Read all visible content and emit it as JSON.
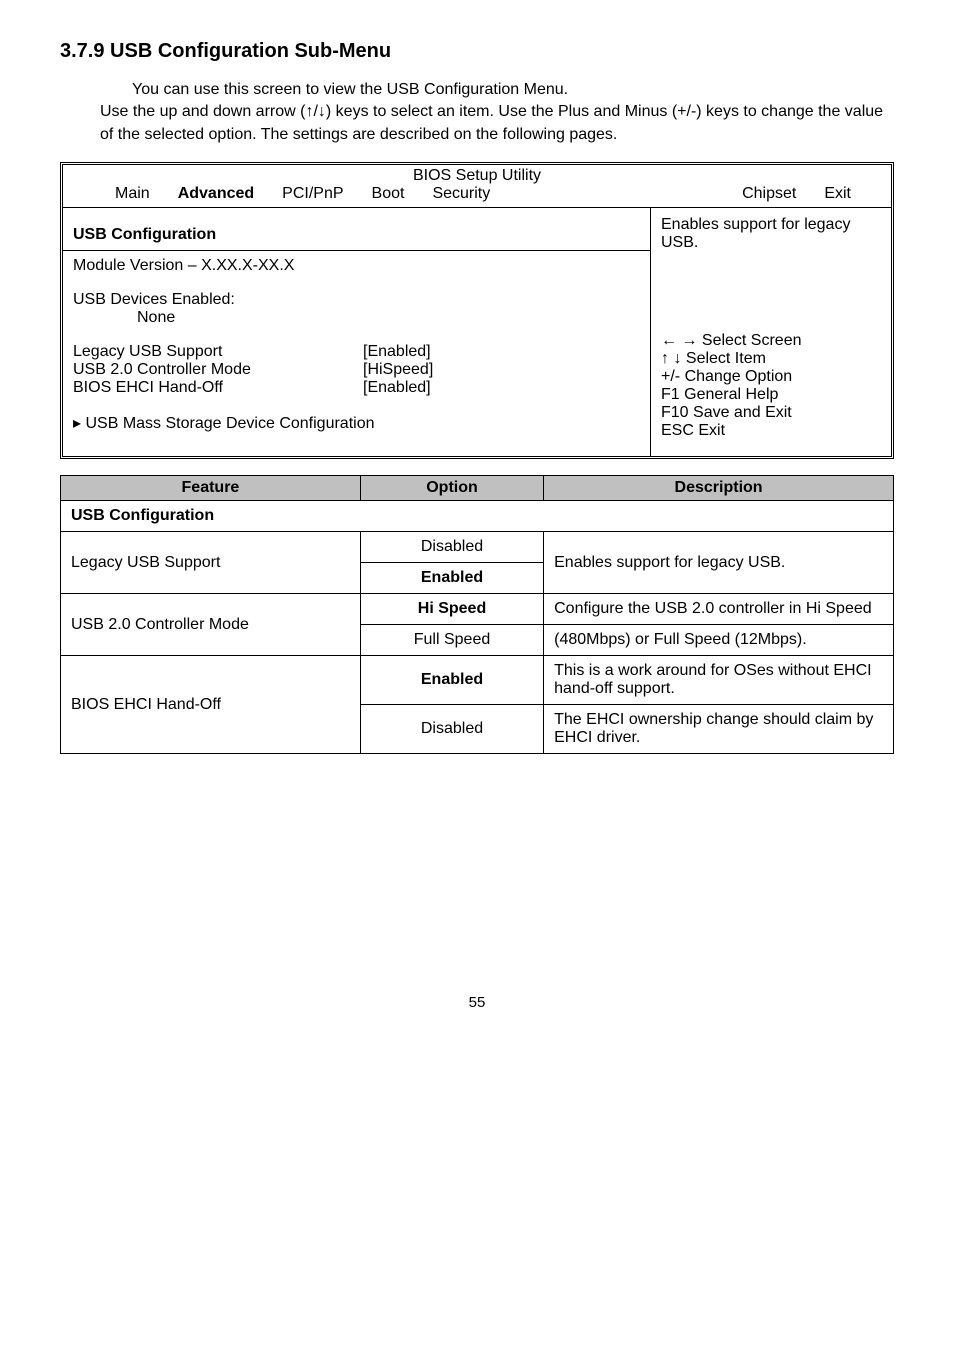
{
  "heading": "3.7.9   USB Configuration Sub-Menu",
  "intro_line1": "You can use this screen to view the USB Configuration Menu.",
  "intro_rest": "Use the up and down arrow (↑/↓) keys to select an item. Use the Plus and Minus (+/-) keys to change the value of the selected option. The settings are described on the following pages.",
  "bios": {
    "title": "BIOS Setup Utility",
    "menu": [
      "Main",
      "Advanced",
      "PCI/PnP",
      "Boot",
      "Security",
      "Chipset",
      "Exit"
    ],
    "section_title": "USB Configuration",
    "module_line": "Module Version – X.XX.X-XX.X",
    "devices_label": "USB Devices Enabled:",
    "devices_value": "None",
    "rows": [
      {
        "label": "Legacy USB Support",
        "value": "[Enabled]"
      },
      {
        "label": "USB 2.0 Controller Mode",
        "value": "[HiSpeed]"
      },
      {
        "label": "BIOS EHCI Hand-Off",
        "value": "[Enabled]"
      }
    ],
    "submenu": "▸ USB Mass Storage Device Configuration",
    "help_title": "Enables support for legacy USB.",
    "help_lines": [
      "← → Select Screen",
      "↑  ↓  Select Item",
      "+/-     Change Option",
      "F1     General Help",
      "F10   Save and Exit",
      "ESC  Exit"
    ]
  },
  "feature_table": {
    "headers": [
      "Feature",
      "Option",
      "Description"
    ],
    "section": "USB Configuration",
    "rows": [
      {
        "feature": "Legacy USB Support",
        "options": [
          "Disabled",
          "Enabled"
        ],
        "bold_idx": 1,
        "description": "Enables support for legacy USB."
      },
      {
        "feature": "USB 2.0 Controller Mode",
        "options": [
          "Hi Speed",
          "Full Speed"
        ],
        "bold_idx": 0,
        "description": [
          "Configure the USB 2.0 controller in Hi Speed",
          "(480Mbps) or Full Speed (12Mbps)."
        ]
      },
      {
        "feature": "BIOS EHCI Hand-Off",
        "options": [
          "Enabled",
          "Disabled"
        ],
        "bold_idx": 0,
        "description": [
          "This is a work around for OSes without EHCI hand-off support.",
          "The EHCI ownership change should claim by EHCI driver."
        ]
      }
    ]
  },
  "page_number": "55"
}
